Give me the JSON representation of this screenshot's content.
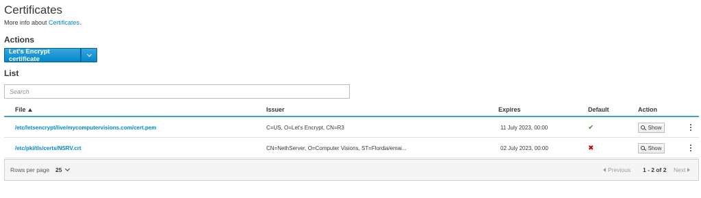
{
  "page": {
    "title": "Certificates",
    "more_info_prefix": "More info about ",
    "more_info_link": "Certificates",
    "more_info_suffix": "."
  },
  "actions": {
    "title": "Actions",
    "primary_label": "Let's Encrypt certificate"
  },
  "list": {
    "title": "List",
    "search_placeholder": "Search"
  },
  "table": {
    "columns": {
      "file": "File",
      "issuer": "Issuer",
      "expires": "Expires",
      "default": "Default",
      "action": "Action"
    },
    "rows": [
      {
        "file": "/etc/letsencrypt/live/mycomputervisions.com/cert.pem",
        "issuer": "C=US, O=Let's Encrypt, CN=R3",
        "expires": "11 July 2023, 00:00",
        "default": "✔",
        "action": "Show"
      },
      {
        "file": "/etc/pki/tls/certs/NSRV.crt",
        "issuer": "CN=NethServer, O=Computer Visions, ST=Flordia/emai...",
        "expires": "02 July 2023, 00:00",
        "default": "✖",
        "action": "Show"
      }
    ]
  },
  "pagination": {
    "rows_per_page_label": "Rows per page",
    "rows_per_page_value": "25",
    "previous_label": "Previous",
    "range": "1 - 2 of 2",
    "next_label": "Next"
  },
  "icons": {
    "sort": "sort-ascending-icon",
    "dropdown": "chevron-down-icon",
    "search": "search-icon",
    "default_yes": "check-icon",
    "default_no": "cross-icon",
    "kebab": "kebab-menu-icon"
  },
  "colors": {
    "accent": "#0088ce",
    "check": "#3f9c35",
    "cross": "#cc0000"
  }
}
